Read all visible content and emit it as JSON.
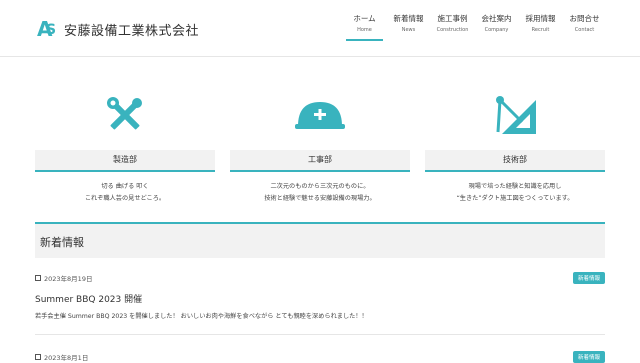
{
  "brand": {
    "name": "安藤設備工業株式会社"
  },
  "nav": [
    {
      "jp": "ホーム",
      "en": "Home",
      "active": true
    },
    {
      "jp": "新着情報",
      "en": "News"
    },
    {
      "jp": "施工事例",
      "en": "Construction"
    },
    {
      "jp": "会社案内",
      "en": "Company"
    },
    {
      "jp": "採用情報",
      "en": "Recruit"
    },
    {
      "jp": "お問合せ",
      "en": "Contact"
    }
  ],
  "services": [
    {
      "icon": "tools-icon",
      "title": "製造部",
      "desc1": "切る 曲げる 叩く",
      "desc2": "これぞ職人芸の見せどころ。"
    },
    {
      "icon": "helmet-icon",
      "title": "工事部",
      "desc1": "二次元のものから三次元のものに。",
      "desc2": "技術と経験で魅せる安藤設備の現場力。"
    },
    {
      "icon": "compass-icon",
      "title": "技術部",
      "desc1": "現場で培った経験と知識を応用し",
      "desc2": "“生きた”ダクト施工図をつくっています。"
    }
  ],
  "news": {
    "heading": "新着情報",
    "posts": [
      {
        "date": "2023年8月19日",
        "badge": "新着情報",
        "title": "Summer BBQ 2023 開催",
        "excerpt": "若手会主催 Summer BBQ 2023 を開催しました！ おいしいお肉や海鮮を食べながら とても親睦を深められました！！"
      },
      {
        "date": "2023年8月1日",
        "badge": "新着情報",
        "title": "",
        "excerpt": ""
      }
    ]
  },
  "colors": {
    "accent": "#39b3be"
  }
}
